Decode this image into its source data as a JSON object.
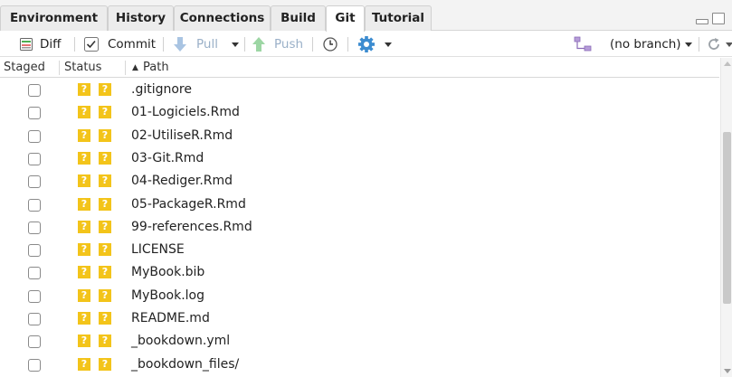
{
  "tabs": [
    {
      "label": "Environment",
      "active": false
    },
    {
      "label": "History",
      "active": false
    },
    {
      "label": "Connections",
      "active": false
    },
    {
      "label": "Build",
      "active": false
    },
    {
      "label": "Git",
      "active": true
    },
    {
      "label": "Tutorial",
      "active": false
    }
  ],
  "toolbar": {
    "diff_label": "Diff",
    "commit_label": "Commit",
    "pull_label": "Pull",
    "push_label": "Push",
    "branch_label": "(no branch)"
  },
  "columns": {
    "staged": "Staged",
    "status": "Status",
    "path": "Path",
    "sort_indicator": "▲"
  },
  "status_glyph": "?",
  "files": [
    {
      "path": ".gitignore",
      "staged": false,
      "status": [
        "?",
        "?"
      ]
    },
    {
      "path": "01-Logiciels.Rmd",
      "staged": false,
      "status": [
        "?",
        "?"
      ]
    },
    {
      "path": "02-UtiliseR.Rmd",
      "staged": false,
      "status": [
        "?",
        "?"
      ]
    },
    {
      "path": "03-Git.Rmd",
      "staged": false,
      "status": [
        "?",
        "?"
      ]
    },
    {
      "path": "04-Rediger.Rmd",
      "staged": false,
      "status": [
        "?",
        "?"
      ]
    },
    {
      "path": "05-PackageR.Rmd",
      "staged": false,
      "status": [
        "?",
        "?"
      ]
    },
    {
      "path": "99-references.Rmd",
      "staged": false,
      "status": [
        "?",
        "?"
      ]
    },
    {
      "path": "LICENSE",
      "staged": false,
      "status": [
        "?",
        "?"
      ]
    },
    {
      "path": "MyBook.bib",
      "staged": false,
      "status": [
        "?",
        "?"
      ]
    },
    {
      "path": "MyBook.log",
      "staged": false,
      "status": [
        "?",
        "?"
      ]
    },
    {
      "path": "README.md",
      "staged": false,
      "status": [
        "?",
        "?"
      ]
    },
    {
      "path": "_bookdown.yml",
      "staged": false,
      "status": [
        "?",
        "?"
      ]
    },
    {
      "path": "_bookdown_files/",
      "staged": false,
      "status": [
        "?",
        "?"
      ]
    }
  ],
  "colors": {
    "untracked_badge": "#f3c41a",
    "tab_bar": "#f3f3f3",
    "disabled_text": "#9ab0c8"
  },
  "icons": {
    "diff": "diff-icon",
    "commit": "commit-checkbox-icon",
    "pull": "pull-arrow-down-icon",
    "push": "push-arrow-up-icon",
    "history": "clock-icon",
    "more": "gear-icon",
    "branch": "branch-icon",
    "refresh": "refresh-icon"
  }
}
